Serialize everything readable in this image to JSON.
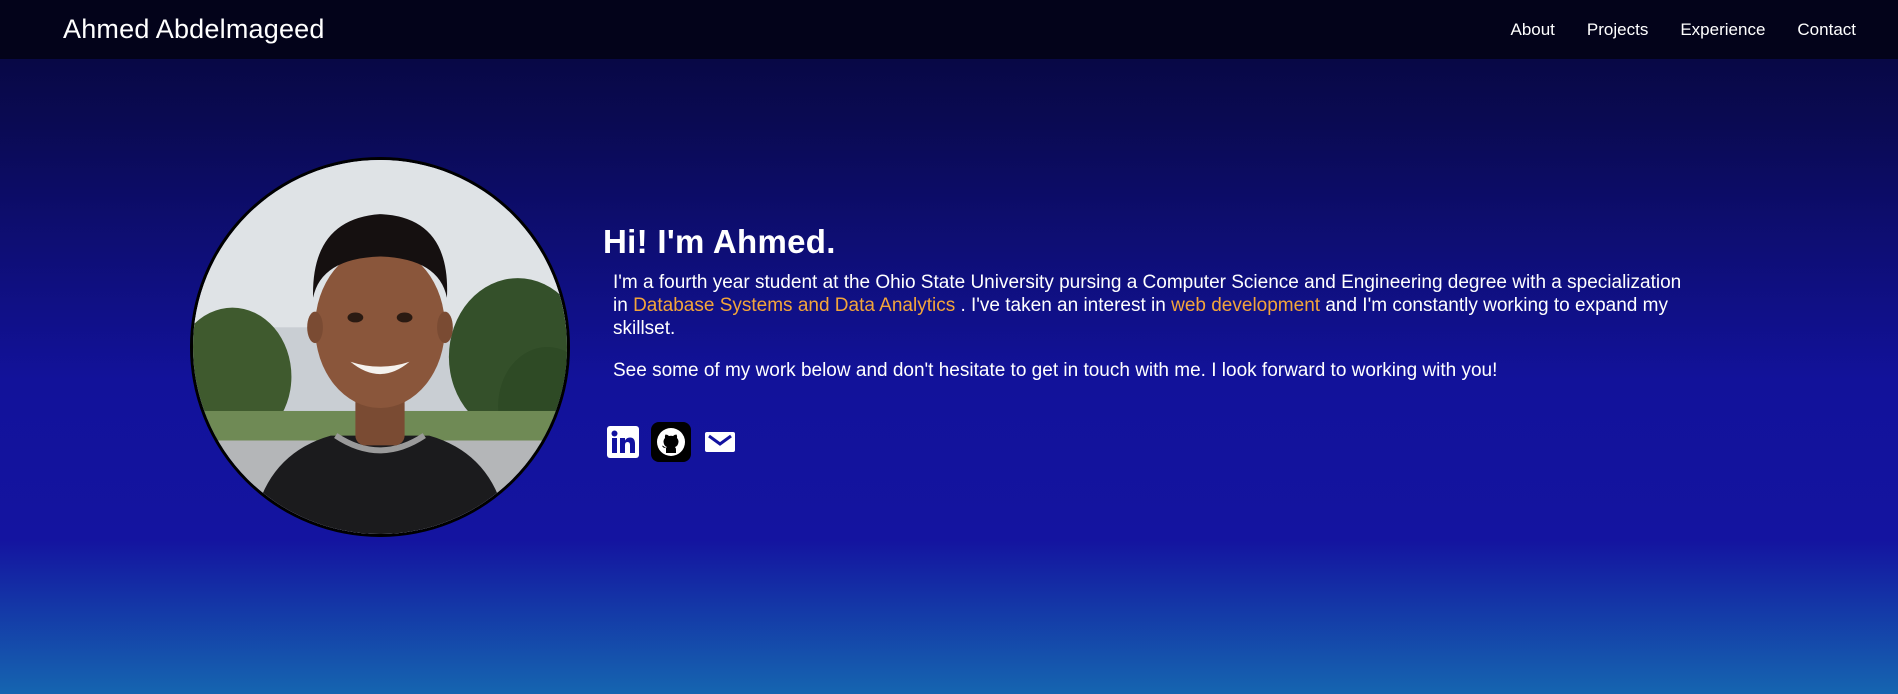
{
  "header": {
    "brand": "Ahmed Abdelmageed",
    "nav": [
      "About",
      "Projects",
      "Experience",
      "Contact"
    ]
  },
  "hero": {
    "greeting": "Hi! I'm Ahmed.",
    "para1": {
      "p1": "I'm a fourth year student at the Ohio State University pursing a Computer Science and Engineering degree with a specialization in ",
      "h1": "Database Systems and Data Analytics",
      "p2": " . I've taken an interest in ",
      "h2": "web development",
      "p3": " and I'm constantly working to expand my skillset."
    },
    "para2": "See some of my work below and don't hesitate to get in touch with me. I look forward to working with you!",
    "socials": [
      "linkedin-icon",
      "github-icon",
      "mail-icon"
    ]
  },
  "colors": {
    "accent": "#f3a53a",
    "navbar": "#03031a",
    "bg_top": "#06063a",
    "bg_mid": "#1414a0",
    "bg_bottom": "#1565b0"
  }
}
